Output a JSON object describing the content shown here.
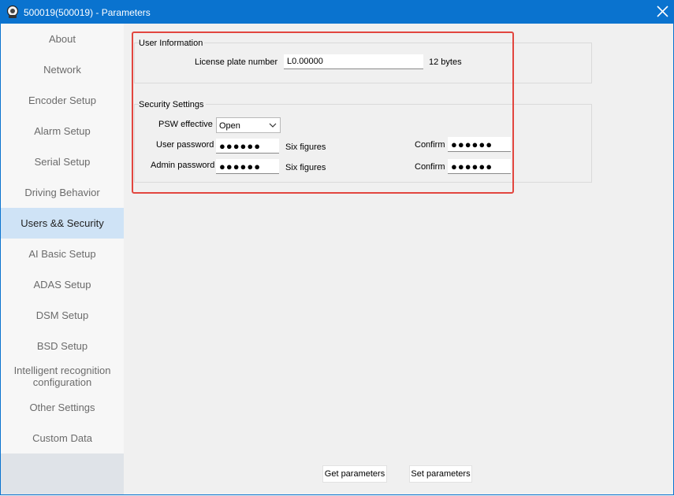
{
  "window": {
    "title": "500019(500019) - Parameters"
  },
  "sidebar": {
    "items": [
      {
        "label": "About"
      },
      {
        "label": "Network"
      },
      {
        "label": "Encoder Setup"
      },
      {
        "label": "Alarm Setup"
      },
      {
        "label": "Serial Setup"
      },
      {
        "label": "Driving Behavior"
      },
      {
        "label": "Users && Security",
        "active": true
      },
      {
        "label": "AI Basic Setup"
      },
      {
        "label": "ADAS Setup"
      },
      {
        "label": "DSM Setup"
      },
      {
        "label": "BSD Setup"
      },
      {
        "label_line1": "Intelligent recognition",
        "label_line2": "configuration"
      },
      {
        "label": "Other Settings"
      },
      {
        "label": "Custom Data"
      }
    ]
  },
  "user_info": {
    "group_label": "User Information",
    "license_label": "License plate number",
    "license_value": "L0.00000",
    "license_hint": "12 bytes"
  },
  "security": {
    "group_label": "Security Settings",
    "psw_label": "PSW effective",
    "psw_value": "Open",
    "user_pwd_label": "User password",
    "user_pwd_value": "●●●●●●",
    "user_pwd_hint": "Six figures",
    "user_confirm_label": "Confirm",
    "user_confirm_value": "●●●●●●",
    "admin_pwd_label": "Admin password",
    "admin_pwd_value": "●●●●●●",
    "admin_pwd_hint": "Six figures",
    "admin_confirm_label": "Confirm",
    "admin_confirm_value": "●●●●●●"
  },
  "buttons": {
    "get": "Get parameters",
    "set": "Set parameters"
  },
  "colors": {
    "titlebar": "#0a73cf",
    "highlight": "#e2463f",
    "active_nav": "#cfe3f6"
  }
}
